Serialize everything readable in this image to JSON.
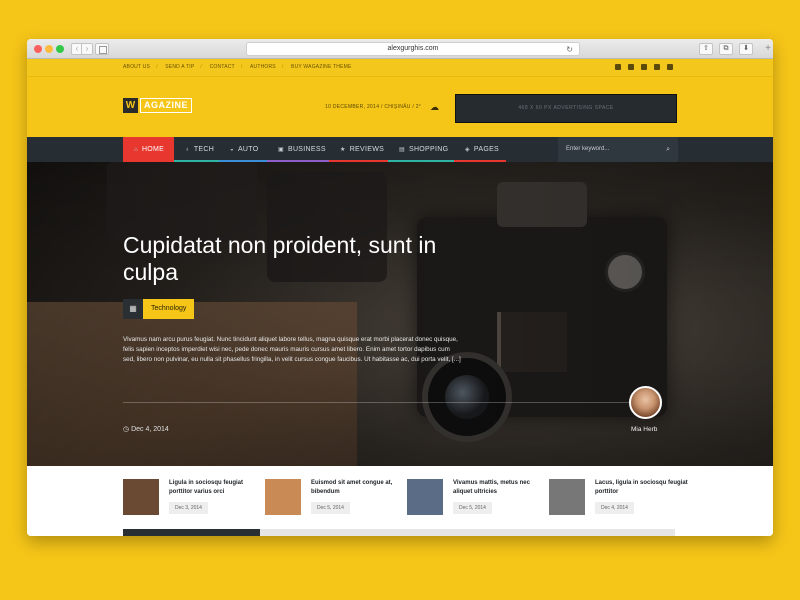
{
  "browser": {
    "url": "alexgurghis.com",
    "nav_back": "‹",
    "nav_forward": "›",
    "reload": "↻",
    "share": "⇧",
    "tabs": "⧉",
    "download": "⬇",
    "new_tab": "+"
  },
  "topbar": {
    "links": [
      "ABOUT US",
      "SEND A TIP",
      "CONTACT",
      "AUTHORS",
      "BUY WAGAZINE THEME"
    ],
    "social_icons": [
      "facebook-icon",
      "twitter-icon",
      "vimeo-icon",
      "google-plus-icon",
      "rss-icon"
    ]
  },
  "header": {
    "logo_mark": "W",
    "logo_text": "AGAZINE",
    "dateline": "10 DECEMBER, 2014 / CHIȘINĂU / 2°",
    "weather_icon": "☁",
    "ad_text": "468 X 60 PX ADVERTISING SPACE"
  },
  "nav": {
    "items": [
      {
        "label": "HOME",
        "icon": "⌂",
        "color": "#e8372f"
      },
      {
        "label": "TECH",
        "icon": "♁",
        "color": "#2fb4a3"
      },
      {
        "label": "AUTO",
        "icon": "◒",
        "color": "#3a8fd6"
      },
      {
        "label": "BUSINESS",
        "icon": "▣",
        "color": "#8e5ec9"
      },
      {
        "label": "REVIEWS",
        "icon": "★",
        "color": "#e8372f"
      },
      {
        "label": "SHOPPING",
        "icon": "▤",
        "color": "#2fb4a3"
      },
      {
        "label": "PAGES",
        "icon": "◈",
        "color": "#e8372f"
      }
    ],
    "search_placeholder": "Enter keyword...",
    "search_icon": "⌕"
  },
  "hero": {
    "title": "Cupidatat non proident, sunt in culpa",
    "tag_icon": "▦",
    "tag": "Technology",
    "excerpt": "Vivamus nam arcu purus feugiat. Nunc tincidunt aliquet labore tellus, magna quisque erat morbi placerat donec quisque, felis sapien inceptos imperdiet wisi nec, pede donec mauris mauris cursus amet libero. Enim amet tortor dapibus cum sed, libero non pulvinar, eu nulla sit phasellus fringilla, in velit cursus congue faucibus. Ut habitasse ac, dui porta velit, [...]",
    "date_icon": "◷",
    "date": "Dec 4, 2014",
    "author": "Mia Herb"
  },
  "posts": [
    {
      "title": "Ligula in sociosqu feugiat porttitor varius orci",
      "date": "Dec 3, 2014",
      "thumb": "#6b4a33"
    },
    {
      "title": "Euismod sit amet congue at, bibendum",
      "date": "Dec 5, 2014",
      "thumb": "#c98a55"
    },
    {
      "title": "Vivamus mattis, metus nec aliquet ultricies",
      "date": "Dec 5, 2014",
      "thumb": "#5a6c86"
    },
    {
      "title": "Lacus, ligula in sociosqu feugiat porttitor",
      "date": "Dec 4, 2014",
      "thumb": "#777777"
    }
  ],
  "colors": {
    "background": "#f5c518",
    "nav_bg": "#262d33",
    "accent_red": "#e8372f"
  }
}
